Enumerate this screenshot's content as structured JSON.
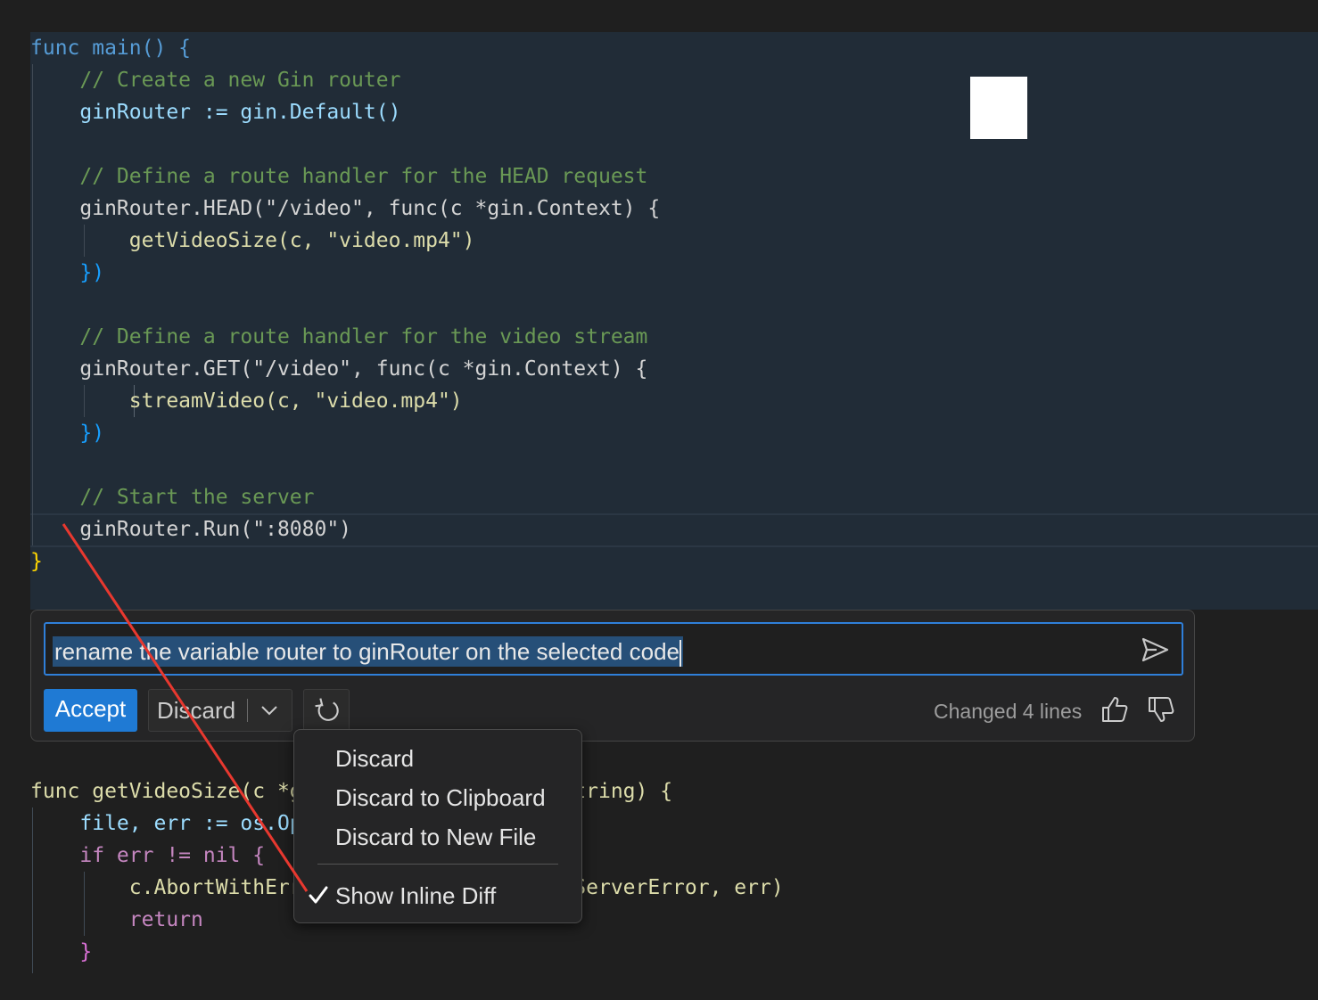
{
  "editor": {
    "top_lines": [
      "func main() {",
      "    // Create a new Gin router",
      "    ginRouter := gin.Default()",
      "",
      "    // Define a route handler for the HEAD request",
      "    ginRouter.HEAD(\"/video\", func(c *gin.Context) {",
      "        getVideoSize(c, \"video.mp4\")",
      "    })",
      "",
      "    // Define a route handler for the video stream",
      "    ginRouter.GET(\"/video\", func(c *gin.Context) {",
      "        streamVideo(c, \"video.mp4\")",
      "    })",
      "",
      "    // Start the server",
      "    ginRouter.Run(\":8080\")",
      "}"
    ],
    "bottom_lines": [
      "func getVideoSize(c *gin.Context, filename string) {",
      "    file, err := os.Open(filename)",
      "    if err != nil {",
      "        c.AbortWithError(http.StatusInternalServerError, err)",
      "        return",
      "    }"
    ]
  },
  "inline_chat": {
    "prompt": "rename the variable router to ginRouter on the selected code",
    "accept_label": "Accept",
    "discard_label": "Discard",
    "status": "Changed 4 lines",
    "icons": [
      "send-icon",
      "chevron-down-icon",
      "refresh-icon",
      "thumbs-up-icon",
      "thumbs-down-icon"
    ]
  },
  "discard_menu": {
    "items": [
      "Discard",
      "Discard to Clipboard",
      "Discard to New File"
    ],
    "toggle_item": "Show Inline Diff",
    "toggle_checked": true
  },
  "colors": {
    "accent": "#1f7ad4",
    "diff_background": "#212c37",
    "annotation_arrow": "#e8382f"
  }
}
